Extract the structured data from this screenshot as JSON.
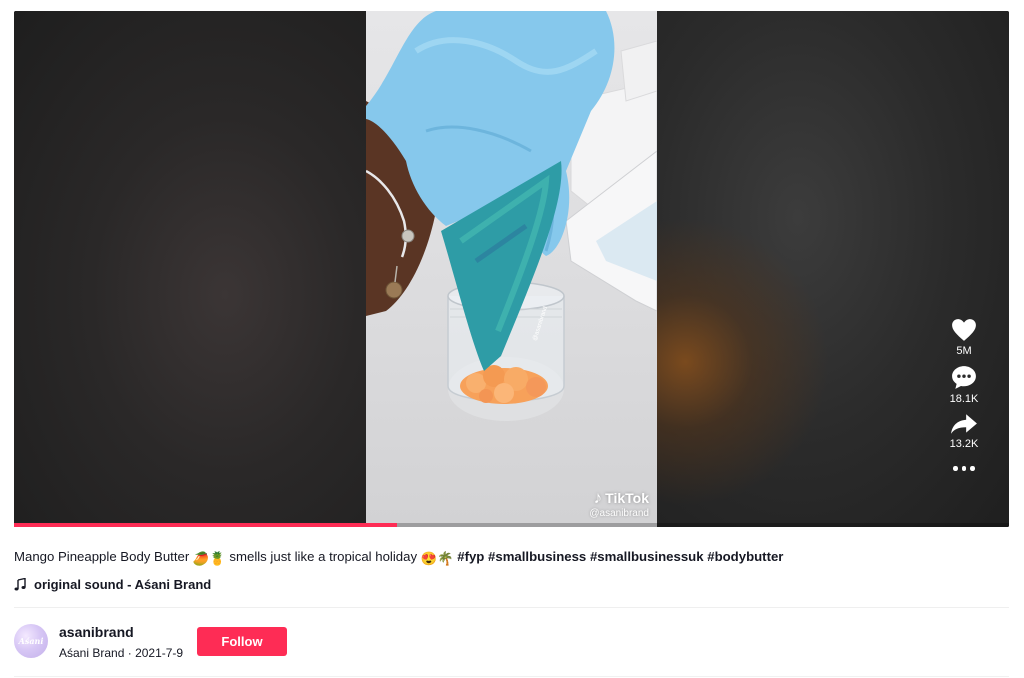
{
  "video": {
    "watermark_brand": "TikTok",
    "watermark_handle": "@asanibrand",
    "jar_label": "@asanibrand",
    "progress_fraction": 0.385
  },
  "actions": {
    "like": {
      "icon": "heart-icon",
      "count": "5M"
    },
    "comment": {
      "icon": "comment-icon",
      "count": "18.1K"
    },
    "share": {
      "icon": "share-icon",
      "count": "13.2K"
    },
    "more": {
      "icon": "more-dots-icon"
    }
  },
  "caption": {
    "text_1": "Mango Pineapple Body Butter",
    "emoji_1": "🥭🍍",
    "text_2": "smells just like a tropical holiday",
    "emoji_2": "😍🌴",
    "hashtags": [
      "#fyp",
      "#smallbusiness",
      "#smallbusinessuk",
      "#bodybutter"
    ]
  },
  "sound": {
    "icon": "music-note-icon",
    "label": "original sound - Aśani Brand"
  },
  "author": {
    "avatar_text": "Aśani",
    "username": "asanibrand",
    "display_name": "Aśani Brand",
    "separator": "·",
    "date": "2021-7-9",
    "follow_label": "Follow"
  },
  "colors": {
    "accent": "#fe2c55",
    "text": "#161823",
    "glove": "#7fc4ea",
    "piping_bag": "#2f9ea8",
    "body_butter": "#f7a15a"
  }
}
